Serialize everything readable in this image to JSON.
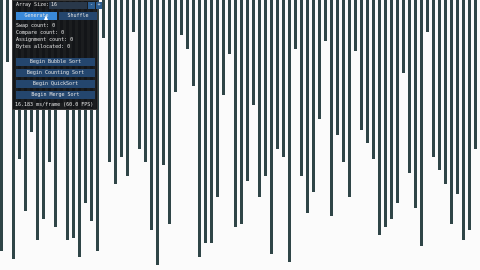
{
  "panel": {
    "array_size_label": "Array Size:",
    "array_size_value": "16",
    "minus_label": "-",
    "plus_label": "+",
    "generate_label": "Generate",
    "shuffle_label": "Shuffle",
    "stats": [
      "Swap count: 0",
      "Compare count: 0",
      "Assignment count: 0",
      "Bytes allocated: 0"
    ],
    "sort_buttons": [
      "Begin Bubble Sort",
      "Begin Counting Sort",
      "Begin QuickSort",
      "Begin Merge Sort"
    ],
    "fps_text": "16.183 ms/frame (60.0 FPS)"
  },
  "visualization": {
    "bar_color": "#2f4547",
    "background_color": "#fbfbfb",
    "bar_heights": [
      0.93,
      0.23,
      0.96,
      0.59,
      0.78,
      0.49,
      0.89,
      0.81,
      0.6,
      0.84,
      0.38,
      0.89,
      0.88,
      0.95,
      0.75,
      0.82,
      0.93,
      0.14,
      0.6,
      0.68,
      0.58,
      0.65,
      0.12,
      0.55,
      0.6,
      0.85,
      0.98,
      0.61,
      0.83,
      0.34,
      0.13,
      0.18,
      0.32,
      0.95,
      0.9,
      0.9,
      0.73,
      0.35,
      0.2,
      0.84,
      0.83,
      0.67,
      0.39,
      0.73,
      0.65,
      0.94,
      0.55,
      0.58,
      0.97,
      0.18,
      0.65,
      0.79,
      0.71,
      0.44,
      0.15,
      0.8,
      0.5,
      0.6,
      0.73,
      0.19,
      0.48,
      0.53,
      0.59,
      0.87,
      0.84,
      0.81,
      0.75,
      0.27,
      0.64,
      0.77,
      0.91,
      0.12,
      0.58,
      0.63,
      0.68,
      0.83,
      0.72,
      0.89,
      0.85,
      0.55
    ]
  }
}
